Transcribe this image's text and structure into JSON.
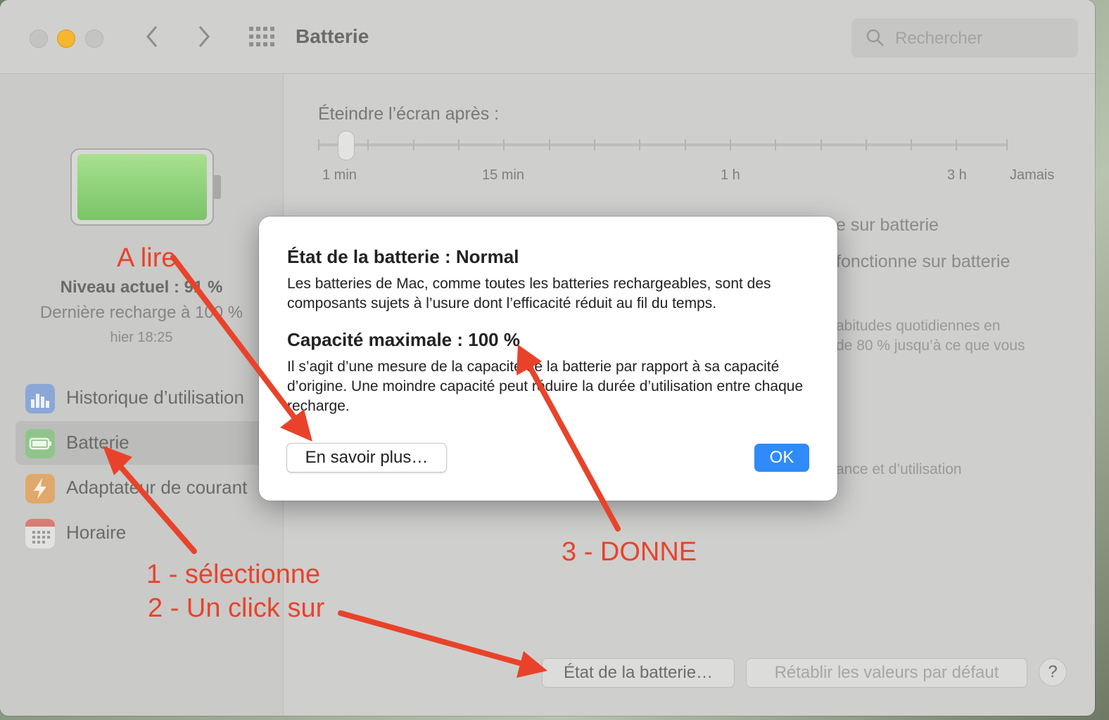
{
  "window": {
    "title": "Batterie",
    "search_placeholder": "Rechercher"
  },
  "colors": {
    "battery_fill": "#8fd27a",
    "accent_blue": "#2f8bf8",
    "annotation_red": "#e8432a",
    "traffic_yellow": "#f5b72e"
  },
  "sidebar": {
    "battery_level": "Niveau actuel : 91 %",
    "last_charge": "Dernière recharge à 100 %",
    "last_charge_time": "hier 18:25",
    "items": [
      {
        "label": "Historique d’utilisation",
        "icon": "bar-chart-icon"
      },
      {
        "label": "Batterie",
        "icon": "battery-icon"
      },
      {
        "label": "Adaptateur de courant",
        "icon": "lightning-icon"
      },
      {
        "label": "Horaire",
        "icon": "calendar-icon"
      }
    ]
  },
  "content": {
    "display_off_label": "Éteindre l’écran après :",
    "slider_ticks": [
      "1 min",
      "15 min",
      "1 h",
      "3 h",
      "Jamais"
    ],
    "partial_1": "e sur batterie",
    "partial_2": "fonctionne sur batterie",
    "partial_3": "abitudes quotidiennes en",
    "partial_4": "de 80 % jusqu’à ce que vous",
    "partial_5": "ance et d’utilisation",
    "battery_health_button": "État de la batterie…",
    "restore_defaults_button": "Rétablir les valeurs par défaut",
    "help_button": "?"
  },
  "dialog": {
    "heading_state": "État de la batterie : Normal",
    "paragraph_state": "Les batteries de Mac, comme toutes les batteries rechargeables, sont des composants sujets à l’usure dont l’efficacité réduit au fil du temps.",
    "heading_capacity": "Capacité maximale : 100 %",
    "paragraph_capacity": "Il s’agit d’une mesure de la capacité de la batterie par rapport à sa capacité d’origine. Une moindre capacité peut réduire la durée d’utilisation entre chaque recharge.",
    "learn_more_button": "En savoir plus…",
    "ok_button": "OK"
  },
  "annotations": {
    "a_lire": "A lire",
    "step1": "1 - sélectionne",
    "step2": "2 - Un click sur",
    "step3": "3 - DONNE"
  }
}
